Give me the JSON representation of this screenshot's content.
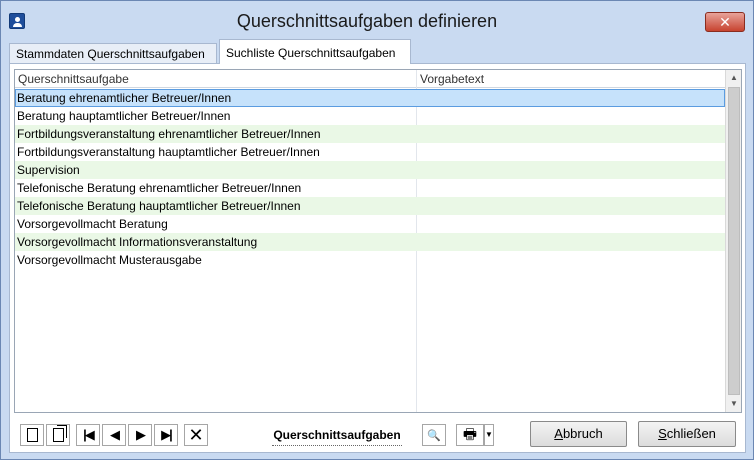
{
  "window": {
    "title": "Querschnittsaufgaben definieren",
    "close_label": "✕"
  },
  "tabs": [
    {
      "label": "Stammdaten Querschnittsaufgaben",
      "active": false
    },
    {
      "label": "Suchliste Querschnittsaufgaben",
      "active": true
    }
  ],
  "grid": {
    "columns": [
      "Querschnittsaufgabe",
      "Vorgabetext"
    ],
    "rows": [
      {
        "c1": "Beratung ehrenamtlicher Betreuer/Innen",
        "c2": "",
        "selected": true
      },
      {
        "c1": "Beratung hauptamtlicher Betreuer/Innen",
        "c2": ""
      },
      {
        "c1": "Fortbildungsveranstaltung ehrenamtlicher Betreuer/Innen",
        "c2": ""
      },
      {
        "c1": "Fortbildungsveranstaltung hauptamtlicher Betreuer/Innen",
        "c2": ""
      },
      {
        "c1": "Supervision",
        "c2": ""
      },
      {
        "c1": "Telefonische Beratung ehrenamtlicher Betreuer/Innen",
        "c2": ""
      },
      {
        "c1": "Telefonische Beratung hauptamtlicher Betreuer/Innen",
        "c2": ""
      },
      {
        "c1": "Vorsorgevollmacht Beratung",
        "c2": ""
      },
      {
        "c1": "Vorsorgevollmacht Informationsveranstaltung",
        "c2": ""
      },
      {
        "c1": "Vorsorgevollmacht Musterausgabe",
        "c2": ""
      }
    ]
  },
  "toolbar": {
    "new_icon": "new-document-icon",
    "copy_icon": "copy-document-icon",
    "first_sym": "|◀",
    "prev_sym": "◀",
    "next_sym": "▶",
    "last_sym": "▶|",
    "delete_sym": "✕",
    "context_label": "Querschnittsaufgaben",
    "search_sym": "🔍",
    "print_sym": "🖶",
    "print_dropdown_sym": "▼"
  },
  "buttons": {
    "abbruch_prefix": "",
    "abbruch_accel": "A",
    "abbruch_rest": "bbruch",
    "schliessen_prefix": "",
    "schliessen_accel": "S",
    "schliessen_rest": "chließen"
  },
  "colors": {
    "title_bar": "#c9daf1",
    "selected_row": "#c6e2fb",
    "alt_row": "#eaf8e6",
    "close_button": "#c7432f"
  }
}
